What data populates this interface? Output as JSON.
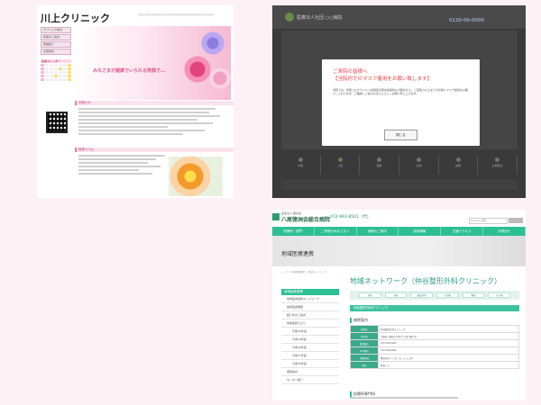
{
  "panel1": {
    "title": "川上クリニック",
    "tagline": "○○○○○○○○○○○○○○○○○○○○○○○○○○○○○○○○",
    "nav": [
      "クリニック案内",
      "診療のご案内",
      "院長紹介",
      "交通案内"
    ],
    "calendar_title": "診療カレンダー",
    "hero_text": "みなさまが健康でいられる笑顔で…",
    "section1": "お知らせ",
    "section2": "院長コラム"
  },
  "panel2": {
    "hospital_name": "医療法人社団 ○○病院",
    "phone": "0120-00-0000",
    "modal_title_1": "ご来院の皆様へ",
    "modal_title_2": "【当院内でのマスク着用をお願い致します】",
    "modal_body": "当院では、新型コロナウイルス感染症の院内感染防止の観点から、ご来院される全ての皆様にマスク着用をお願いしております。ご理解とご協力のほどよろしくお願い申し上げます。",
    "close_label": "閉じる",
    "nav": [
      "外来",
      "入院",
      "健診",
      "交通",
      "採用",
      "お問合せ"
    ]
  },
  "panel3": {
    "org": "医療法人 藤井会",
    "hospital": "八尾徳洲会総合病院",
    "phone": "072-993-8501（代）",
    "search_placeholder": "Google 検索",
    "nav": [
      "診療科・部門",
      "ご来院のみなさまへ",
      "病院のご案内",
      "採用情報",
      "交通アクセス",
      "お問合せ"
    ],
    "banner": "地域医療連携",
    "breadcrumb": "トップ > 地域医療連携 > 地域ネットワーク",
    "side_head": "地域医療連携",
    "side_items": [
      "地域医療連携ネットワーク",
      "連携医療機関",
      "紹介状のご案内",
      "地域連携だより",
      "平成30年度",
      "平成29年度",
      "平成28年度",
      "平成27年度",
      "平成26年度",
      "病院案内",
      "センター紹介"
    ],
    "heading": "地域ネットワーク（仲谷整形外科クリニック）",
    "tabs": [
      "内科",
      "外科",
      "整形外科",
      "小児科",
      "眼科",
      "その他"
    ],
    "clinic_bar": "仲谷整形外科クリニック",
    "section_info": "病院案内",
    "table": [
      [
        "病院名",
        "仲谷整形外科クリニック"
      ],
      [
        "所在地",
        "大阪府八尾市〇〇町〇丁目〇番〇号"
      ],
      [
        "電話番号",
        "072-000-0000"
      ],
      [
        "FAX番号",
        "072-000-0000"
      ],
      [
        "診療科目",
        "整形外科 リハビリテーション科"
      ],
      [
        "院長",
        "仲谷 ○○"
      ]
    ],
    "section_doctors": "診療所専門科"
  }
}
